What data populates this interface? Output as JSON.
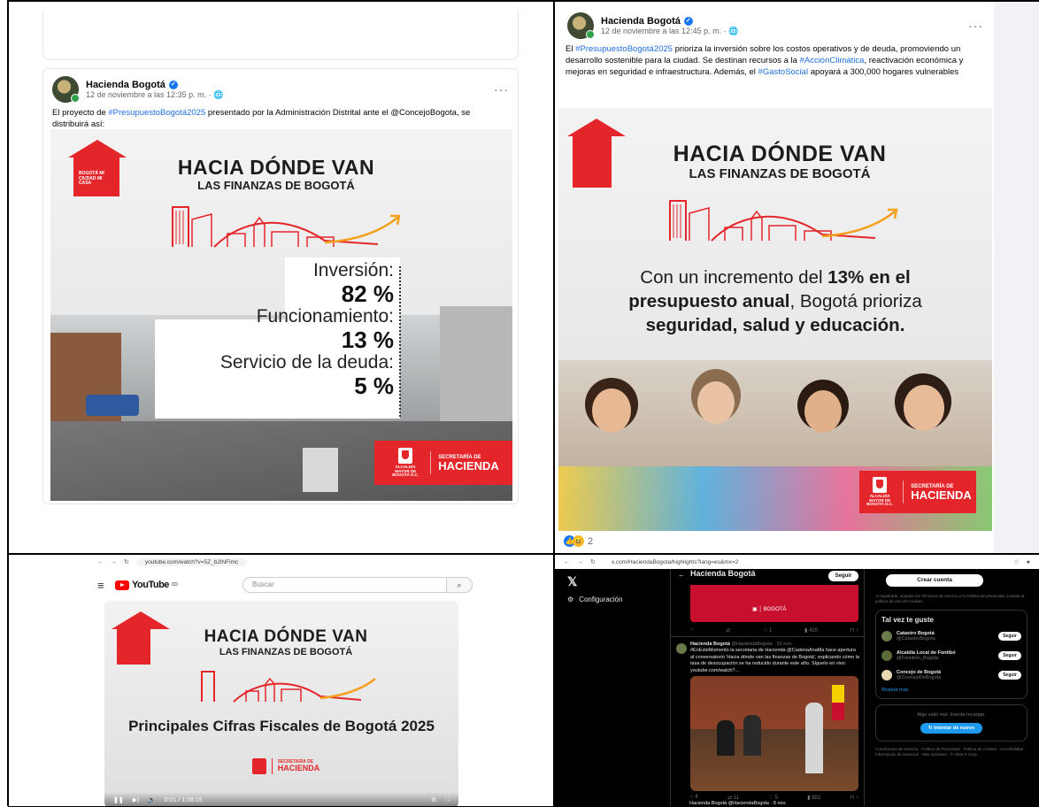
{
  "top_left": {
    "post": {
      "author": "Hacienda Bogotá",
      "time": "12 de noviembre a las 12:35 p. m. · ",
      "text_before": "El proyecto de ",
      "hashtag": "#PresupuestoBogotá2025",
      "text_after": " presentado por la Administración Distrital ante el @ConcejoBogota, se distribuirá así:",
      "more": "···"
    },
    "info": {
      "title1": "HACIA DÓNDE VAN",
      "title2": "LAS FINANZAS DE BOGOTÁ",
      "logo_text": "BOGOTÁ MI CIUDAD MI CASA",
      "stats": [
        {
          "label": "Inversión:",
          "value": "82 %"
        },
        {
          "label": "Funcionamiento:",
          "value": "13 %"
        },
        {
          "label": "Servicio de la deuda:",
          "value": "5 %"
        }
      ],
      "badge_small": "ALCALDÍA MAYOR DE BOGOTÁ D.C.",
      "badge_t1": "SECRETARÍA DE",
      "badge_t2": "HACIENDA"
    }
  },
  "top_right": {
    "post": {
      "author": "Hacienda Bogotá",
      "time": "12 de noviembre a las 12:45 p. m. · ",
      "more": "···",
      "t1": "El ",
      "h1": "#PresupuestoBogotá2025",
      "t2": " prioriza la inversión sobre los costos operativos y de deuda, promoviendo un desarrollo sostenible para la ciudad. Se destinan recursos a la ",
      "h2": "#AcciónClimática",
      "t3": ", reactivación económica y mejoras en seguridad e infraestructura. Además, el ",
      "h3": "#GastoSocial",
      "t4": " apoyará a 300,000 hogares vulnerables"
    },
    "info": {
      "title1": "HACIA DÓNDE VAN",
      "title2": "LAS FINANZAS DE BOGOTÁ",
      "line1_a": "Con un incremento del ",
      "line1_b": "13% en el",
      "line2_a": "presupuesto anual",
      "line2_b": ", Bogotá prioriza",
      "line3": "seguridad, salud y educación.",
      "badge_small": "ALCALDÍA MAYOR DE BOGOTÁ D.C.",
      "badge_t1": "SECRETARÍA DE",
      "badge_t2": "HACIENDA"
    },
    "reactions_count": "2"
  },
  "bottom_left": {
    "url": "youtube.com/watch?v=5Z_b2lNFimc",
    "logo": "YouTube",
    "logo_sup": "CO",
    "search_placeholder": "Buscar",
    "video": {
      "title1": "HACIA DÓNDE VAN",
      "title2": "LAS FINANZAS DE BOGOTÁ",
      "subtitle": "Principales Cifras Fiscales de Bogotá 2025",
      "badge_t1": "SECRETARÍA DE",
      "badge_t2": "HACIENDA",
      "time": "0:01 / 1:08:16"
    }
  },
  "bottom_right": {
    "url": "x.com/HaciendaBogota/highlights?lang=es&mx=2",
    "config": "Configuración",
    "profile_name": "Hacienda Bogotá",
    "follow": "Seguir",
    "create_account": "Crear cuenta",
    "legal": "Al registrarte, aceptas los Términos de servicio y la Política de privacidad, incluida la política de Uso de Cookies.",
    "tweet": {
      "author": "Hacienda Bogotá",
      "handle": "@HaciendaBogota · 12 nov.",
      "text": "#EnEsteMomento la secretaria de Hacienda @CadenaAnaMa hace apertura al conversatorio 'Hacia dónde van las finanzas de Bogotá', explicando cómo la tasa de desocupación se ha reducido durante este año. Síguelo en vivo: youtube.com/watch?...",
      "stats": [
        "4",
        "11",
        "5",
        "882"
      ],
      "top_stats": [
        "",
        "",
        "1",
        "420"
      ]
    },
    "suggest_title": "Tal vez te guste",
    "suggestions": [
      {
        "name": "Catastro Bogotá",
        "handle": "@CatastroBogota"
      },
      {
        "name": "Alcaldía Local de Fontibó",
        "handle": "@Fontibon_Bogota"
      },
      {
        "name": "Concejo de Bogotá",
        "handle": "@ConcejoDeBogota"
      }
    ],
    "show_more": "Mostrar más",
    "error": "Algo salió mal. Intenta recargar.",
    "retry": "Intentar de nuevo",
    "footer": "Condiciones de Servicio · Política de Privacidad · Política de cookies · Accesibilidad · Información de anuncios · Más opciones · © 2024 X Corp.",
    "next_tweet": "Hacienda Bogotá @HaciendaBogota · 8 nov."
  }
}
